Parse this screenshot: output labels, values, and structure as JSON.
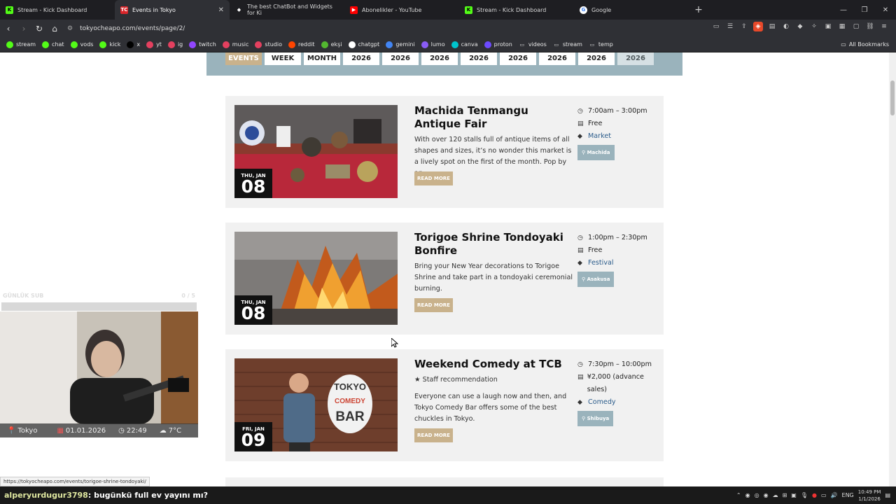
{
  "browser": {
    "tabs": [
      {
        "label": "Stream - Kick Dashboard",
        "icon": "kick-icon",
        "color": "#53fc18"
      },
      {
        "label": "Events in Tokyo",
        "icon": "tc-icon",
        "color": "#d9252a",
        "active": true
      },
      {
        "label": "The best ChatBot and Widgets for Ki",
        "icon": "widget-icon",
        "color": "#ffffff"
      },
      {
        "label": "Abonelikler - YouTube",
        "icon": "youtube-icon",
        "color": "#ff0000"
      },
      {
        "label": "Stream - Kick Dashboard",
        "icon": "kick-icon",
        "color": "#53fc18"
      },
      {
        "label": "Google",
        "icon": "google-icon",
        "color": "#4285f4"
      }
    ],
    "url": "tokyocheapo.com/events/page/2/",
    "bookmarks": [
      "stream",
      "chat",
      "vods",
      "kick",
      "x",
      "yt",
      "ig",
      "twitch",
      "music",
      "studio",
      "reddit",
      "ekşi",
      "chatgpt",
      "gemini",
      "lumo",
      "canva",
      "proton",
      "videos",
      "stream",
      "temp"
    ],
    "all_bookmarks": "All Bookmarks"
  },
  "filters": [
    "EVENTS",
    "WEEK",
    "MONTH",
    "2026",
    "2026",
    "2026",
    "2026",
    "2026",
    "2026",
    "2026",
    "2026"
  ],
  "events": [
    {
      "title": "Machida Tenmangu Antique Fair",
      "weekday": "THU, JAN",
      "day": "08",
      "desc": "With over 120 stalls full of antique items of all shapes and sizes, it’s no wonder this market is a lively spot on the first of the month. Pop by an...",
      "read_more": "READ MORE",
      "time": "7:00am – 3:00pm",
      "price": "Free",
      "category": "Market",
      "area": "Machida"
    },
    {
      "title": "Torigoe Shrine Tondoyaki Bonfire",
      "weekday": "THU, JAN",
      "day": "08",
      "desc": "Bring your New Year decorations to Torigoe Shrine and take part in a tondoyaki ceremonial burning.",
      "read_more": "READ MORE",
      "time": "1:00pm – 2:30pm",
      "price": "Free",
      "category": "Festival",
      "area": "Asakusa"
    },
    {
      "title": "Weekend Comedy at TCB",
      "weekday": "FRI, JAN",
      "day": "09",
      "staff": "★ Staff recommendation",
      "desc": "Everyone can use a laugh now and then, and Tokyo Comedy Bar offers some of the best chuckles in Tokyo.",
      "read_more": "READ MORE",
      "time": "7:30pm – 10:00pm",
      "price": "¥2,000 (advance sales)",
      "category": "Comedy",
      "area": "Shibuya",
      "sign": "TOKYO COMEDY BAR"
    }
  ],
  "overlay": {
    "label": "GÜNLÜK SUB",
    "count": "0 / 5",
    "city": "Tokyo",
    "date": "01.01.2026",
    "time": "22:49",
    "temp": "7°C"
  },
  "status_url": "https://tokyocheapo.com/events/torigoe-shrine-tondoyaki/",
  "chat": {
    "user": "alperyurdugur3798",
    "message": ": bugünkü full ev yayını mı?"
  },
  "taskbar": {
    "lang": "ENG",
    "time": "10:49 PM",
    "date": "1/1/2026"
  }
}
